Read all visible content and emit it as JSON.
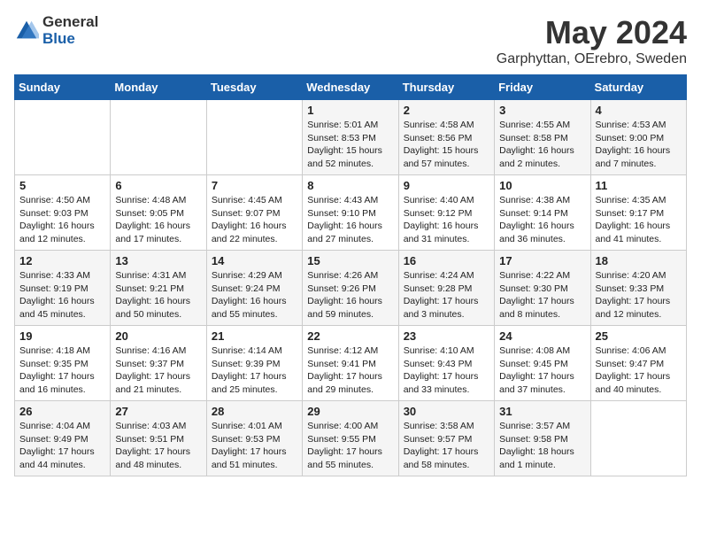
{
  "logo": {
    "general": "General",
    "blue": "Blue"
  },
  "title": "May 2024",
  "subtitle": "Garphyttan, OErebro, Sweden",
  "headers": [
    "Sunday",
    "Monday",
    "Tuesday",
    "Wednesday",
    "Thursday",
    "Friday",
    "Saturday"
  ],
  "weeks": [
    [
      {
        "day": "",
        "info": ""
      },
      {
        "day": "",
        "info": ""
      },
      {
        "day": "",
        "info": ""
      },
      {
        "day": "1",
        "info": "Sunrise: 5:01 AM\nSunset: 8:53 PM\nDaylight: 15 hours\nand 52 minutes."
      },
      {
        "day": "2",
        "info": "Sunrise: 4:58 AM\nSunset: 8:56 PM\nDaylight: 15 hours\nand 57 minutes."
      },
      {
        "day": "3",
        "info": "Sunrise: 4:55 AM\nSunset: 8:58 PM\nDaylight: 16 hours\nand 2 minutes."
      },
      {
        "day": "4",
        "info": "Sunrise: 4:53 AM\nSunset: 9:00 PM\nDaylight: 16 hours\nand 7 minutes."
      }
    ],
    [
      {
        "day": "5",
        "info": "Sunrise: 4:50 AM\nSunset: 9:03 PM\nDaylight: 16 hours\nand 12 minutes."
      },
      {
        "day": "6",
        "info": "Sunrise: 4:48 AM\nSunset: 9:05 PM\nDaylight: 16 hours\nand 17 minutes."
      },
      {
        "day": "7",
        "info": "Sunrise: 4:45 AM\nSunset: 9:07 PM\nDaylight: 16 hours\nand 22 minutes."
      },
      {
        "day": "8",
        "info": "Sunrise: 4:43 AM\nSunset: 9:10 PM\nDaylight: 16 hours\nand 27 minutes."
      },
      {
        "day": "9",
        "info": "Sunrise: 4:40 AM\nSunset: 9:12 PM\nDaylight: 16 hours\nand 31 minutes."
      },
      {
        "day": "10",
        "info": "Sunrise: 4:38 AM\nSunset: 9:14 PM\nDaylight: 16 hours\nand 36 minutes."
      },
      {
        "day": "11",
        "info": "Sunrise: 4:35 AM\nSunset: 9:17 PM\nDaylight: 16 hours\nand 41 minutes."
      }
    ],
    [
      {
        "day": "12",
        "info": "Sunrise: 4:33 AM\nSunset: 9:19 PM\nDaylight: 16 hours\nand 45 minutes."
      },
      {
        "day": "13",
        "info": "Sunrise: 4:31 AM\nSunset: 9:21 PM\nDaylight: 16 hours\nand 50 minutes."
      },
      {
        "day": "14",
        "info": "Sunrise: 4:29 AM\nSunset: 9:24 PM\nDaylight: 16 hours\nand 55 minutes."
      },
      {
        "day": "15",
        "info": "Sunrise: 4:26 AM\nSunset: 9:26 PM\nDaylight: 16 hours\nand 59 minutes."
      },
      {
        "day": "16",
        "info": "Sunrise: 4:24 AM\nSunset: 9:28 PM\nDaylight: 17 hours\nand 3 minutes."
      },
      {
        "day": "17",
        "info": "Sunrise: 4:22 AM\nSunset: 9:30 PM\nDaylight: 17 hours\nand 8 minutes."
      },
      {
        "day": "18",
        "info": "Sunrise: 4:20 AM\nSunset: 9:33 PM\nDaylight: 17 hours\nand 12 minutes."
      }
    ],
    [
      {
        "day": "19",
        "info": "Sunrise: 4:18 AM\nSunset: 9:35 PM\nDaylight: 17 hours\nand 16 minutes."
      },
      {
        "day": "20",
        "info": "Sunrise: 4:16 AM\nSunset: 9:37 PM\nDaylight: 17 hours\nand 21 minutes."
      },
      {
        "day": "21",
        "info": "Sunrise: 4:14 AM\nSunset: 9:39 PM\nDaylight: 17 hours\nand 25 minutes."
      },
      {
        "day": "22",
        "info": "Sunrise: 4:12 AM\nSunset: 9:41 PM\nDaylight: 17 hours\nand 29 minutes."
      },
      {
        "day": "23",
        "info": "Sunrise: 4:10 AM\nSunset: 9:43 PM\nDaylight: 17 hours\nand 33 minutes."
      },
      {
        "day": "24",
        "info": "Sunrise: 4:08 AM\nSunset: 9:45 PM\nDaylight: 17 hours\nand 37 minutes."
      },
      {
        "day": "25",
        "info": "Sunrise: 4:06 AM\nSunset: 9:47 PM\nDaylight: 17 hours\nand 40 minutes."
      }
    ],
    [
      {
        "day": "26",
        "info": "Sunrise: 4:04 AM\nSunset: 9:49 PM\nDaylight: 17 hours\nand 44 minutes."
      },
      {
        "day": "27",
        "info": "Sunrise: 4:03 AM\nSunset: 9:51 PM\nDaylight: 17 hours\nand 48 minutes."
      },
      {
        "day": "28",
        "info": "Sunrise: 4:01 AM\nSunset: 9:53 PM\nDaylight: 17 hours\nand 51 minutes."
      },
      {
        "day": "29",
        "info": "Sunrise: 4:00 AM\nSunset: 9:55 PM\nDaylight: 17 hours\nand 55 minutes."
      },
      {
        "day": "30",
        "info": "Sunrise: 3:58 AM\nSunset: 9:57 PM\nDaylight: 17 hours\nand 58 minutes."
      },
      {
        "day": "31",
        "info": "Sunrise: 3:57 AM\nSunset: 9:58 PM\nDaylight: 18 hours\nand 1 minute."
      },
      {
        "day": "",
        "info": ""
      }
    ]
  ]
}
